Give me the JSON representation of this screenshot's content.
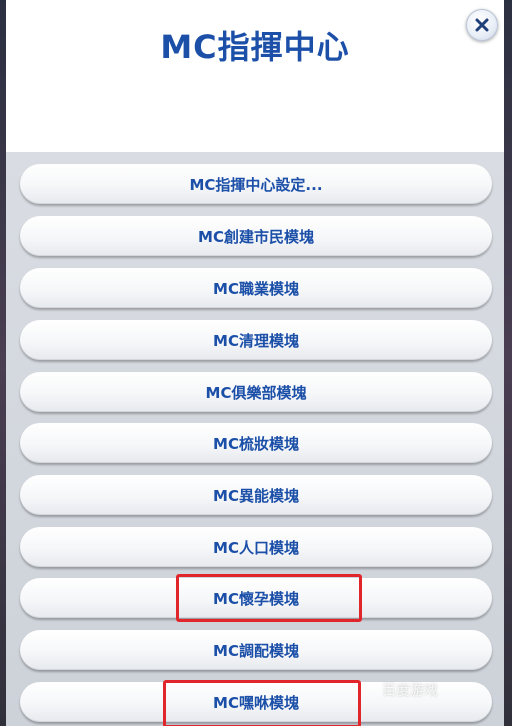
{
  "dialog": {
    "title": "MC指揮中心",
    "close_icon": "close-icon"
  },
  "menu": {
    "items": [
      {
        "label": "MC指揮中心設定..."
      },
      {
        "label": "MC創建市民模塊"
      },
      {
        "label": "MC職業模塊"
      },
      {
        "label": "MC清理模塊"
      },
      {
        "label": "MC俱樂部模塊"
      },
      {
        "label": "MC梳妝模塊"
      },
      {
        "label": "MC異能模塊"
      },
      {
        "label": "MC人口模塊"
      },
      {
        "label": "MC懷孕模塊"
      },
      {
        "label": "MC調配模塊"
      },
      {
        "label": "MC嘿咻模塊"
      }
    ]
  },
  "watermark": {
    "text": "百度游戏"
  },
  "colors": {
    "accent": "#1b4fa8",
    "highlight": "#e0262b",
    "list_background": "#d3d7de"
  }
}
